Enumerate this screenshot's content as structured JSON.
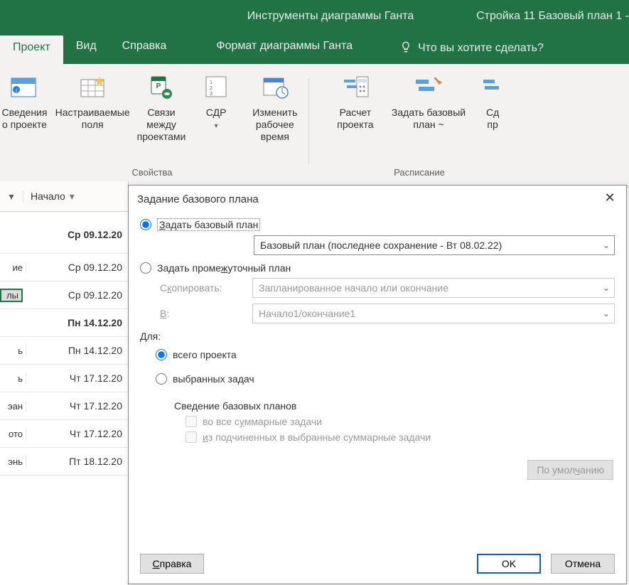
{
  "titlebar": {
    "tools_title": "Инструменты диаграммы Ганта",
    "file_title": "Стройка 11 Базовый план 1 -"
  },
  "tabs": {
    "project": "Проект",
    "view": "Вид",
    "help": "Справка",
    "format": "Формат диаграммы Ганта",
    "tellme": "Что вы хотите сделать?"
  },
  "ribbon": {
    "info": {
      "line1": "Сведения",
      "line2": "о проекте"
    },
    "custom_fields": {
      "line1": "Настраиваемые",
      "line2": "поля"
    },
    "links": {
      "line1": "Связи между",
      "line2": "проектами"
    },
    "wbs": {
      "line1": "СДР",
      "line2": ""
    },
    "worktime": {
      "line1": "Изменить",
      "line2": "рабочее время"
    },
    "calc": {
      "line1": "Расчет",
      "line2": "проекта"
    },
    "baseline": {
      "line1": "Задать базовый",
      "line2": "план ~"
    },
    "move": {
      "line1": "Сд",
      "line2": "пр"
    },
    "group_props": "Свойства",
    "group_schedule": "Расписание"
  },
  "grid": {
    "col_start": "Начало",
    "rows": [
      {
        "left": "",
        "date": "Ср 09.12.20",
        "bold": true,
        "selected": false
      },
      {
        "left": "ие",
        "date": "Ср 09.12.20",
        "bold": false,
        "selected": false
      },
      {
        "left": "лы",
        "date": "Ср 09.12.20",
        "bold": false,
        "selected": true
      },
      {
        "left": "",
        "date": "Пн 14.12.20",
        "bold": true,
        "selected": false
      },
      {
        "left": "ь",
        "date": "Пн 14.12.20",
        "bold": false,
        "selected": false
      },
      {
        "left": "ь",
        "date": "Чт 17.12.20",
        "bold": false,
        "selected": false
      },
      {
        "left": "эан",
        "date": "Чт 17.12.20",
        "bold": false,
        "selected": false
      },
      {
        "left": "ото",
        "date": "Чт 17.12.20",
        "bold": false,
        "selected": false
      },
      {
        "left": "энь",
        "date": "Пт 18.12.20",
        "bold": false,
        "selected": false
      }
    ]
  },
  "dialog": {
    "title": "Задание базового плана",
    "opt_set_baseline": "Задать базовый план",
    "baseline_combo": "Базовый план (последнее сохранение - Вт 08.02.22)",
    "opt_set_interim": "Задать промежуточный план",
    "lbl_copy": "Скопировать:",
    "lbl_copy_u": "к",
    "copy_combo": "Запланированное начало или окончание",
    "lbl_into": "В:",
    "into_combo": "Начало1/окончание1",
    "lbl_for": "Для:",
    "opt_whole": "всего проекта",
    "opt_selected": "выбранных задач",
    "section_merge": "Сведение базовых планов",
    "chk_all_summary": "во все суммарные задачи",
    "chk_sub_to_sel": "из подчиненных в выбранные суммарные задачи",
    "btn_default": "По умолчанию",
    "btn_help": "Справка",
    "btn_ok": "OK",
    "btn_cancel": "Отмена"
  }
}
